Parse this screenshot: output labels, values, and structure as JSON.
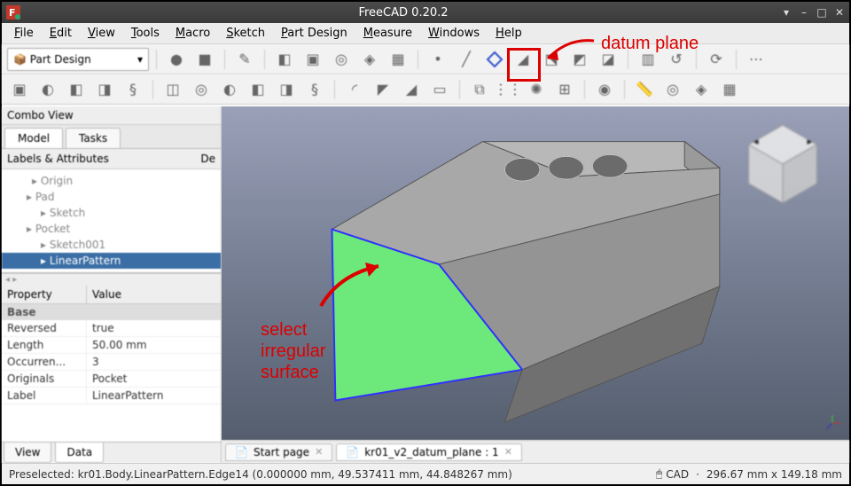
{
  "title": "FreeCAD 0.20.2",
  "menubar": [
    "File",
    "Edit",
    "View",
    "Tools",
    "Macro",
    "Sketch",
    "Part Design",
    "Measure",
    "Windows",
    "Help"
  ],
  "workbench": "Part Design",
  "combo": {
    "title": "Combo View",
    "tabs": [
      "Model",
      "Tasks"
    ],
    "section_header": "Labels & Attributes",
    "section_header_right": "De",
    "tree": [
      {
        "label": "Origin",
        "indent": 34
      },
      {
        "label": "Pad",
        "indent": 28
      },
      {
        "label": "Sketch",
        "indent": 44
      },
      {
        "label": "Pocket",
        "indent": 28
      },
      {
        "label": "Sketch001",
        "indent": 44
      },
      {
        "label": "LinearPattern",
        "indent": 44,
        "selected": true
      }
    ],
    "prop_header": [
      "Property",
      "Value"
    ],
    "prop_group": "Base",
    "props": [
      {
        "k": "Reversed",
        "v": "true"
      },
      {
        "k": "Length",
        "v": "50.00 mm"
      },
      {
        "k": "Occurren...",
        "v": "3"
      },
      {
        "k": "Originals",
        "v": "Pocket"
      },
      {
        "k": "Label",
        "v": "LinearPattern"
      }
    ],
    "bottom_tabs": [
      "View",
      "Data"
    ]
  },
  "doc_tabs": [
    {
      "label": "Start page",
      "active": false
    },
    {
      "label": "kr01_v2_datum_plane : 1",
      "active": true
    }
  ],
  "status": {
    "left": "Preselected: kr01.Body.LinearPattern.Edge14 (0.000000 mm, 49.537411 mm, 44.848267 mm)",
    "mid": "CAD",
    "right": "296.67 mm x 149.18 mm"
  },
  "annotations": {
    "datum_label": "datum plane",
    "select_label": "select\nirregular\nsurface"
  }
}
